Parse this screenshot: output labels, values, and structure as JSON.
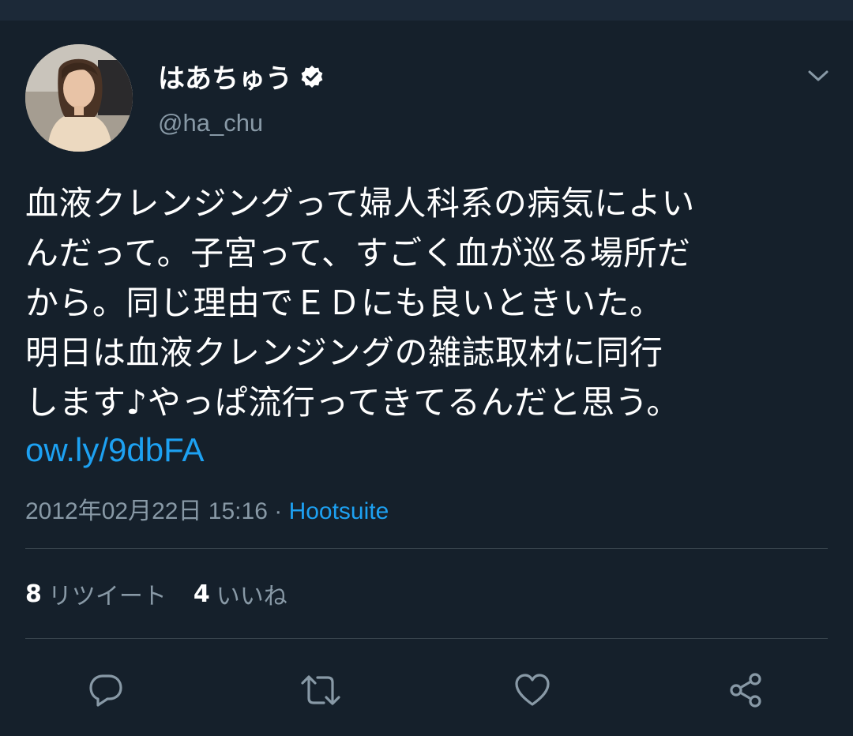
{
  "user": {
    "display_name": "はあちゅう",
    "handle": "@ha_chu",
    "avatar_icon": "profile-photo",
    "verified_icon": "verified-badge-icon"
  },
  "tweet": {
    "lines": [
      "血液クレンジングって婦人科系の病気によい",
      "んだって。子宮って、すごく血が巡る場所だ",
      "から。同じ理由でＥＤにも良いときいた。",
      "明日は血液クレンジングの雑誌取材に同行",
      "します♪やっぱ流行ってきてるんだと思う。"
    ],
    "link": "ow.ly/9dbFA",
    "timestamp": "2012年02月22日 15:16",
    "separator": " · ",
    "source": "Hootsuite"
  },
  "stats": {
    "retweets_count": "8",
    "retweets_label": "リツイート",
    "likes_count": "4",
    "likes_label": "いいね"
  },
  "actions": {
    "reply_icon": "reply-icon",
    "retweet_icon": "retweet-icon",
    "like_icon": "heart-icon",
    "share_icon": "share-icon",
    "menu_icon": "chevron-down-icon"
  },
  "colors": {
    "background": "#15202b",
    "text": "#ffffff",
    "secondary": "#8899a6",
    "accent": "#1da1f2",
    "divider": "#38444d"
  }
}
